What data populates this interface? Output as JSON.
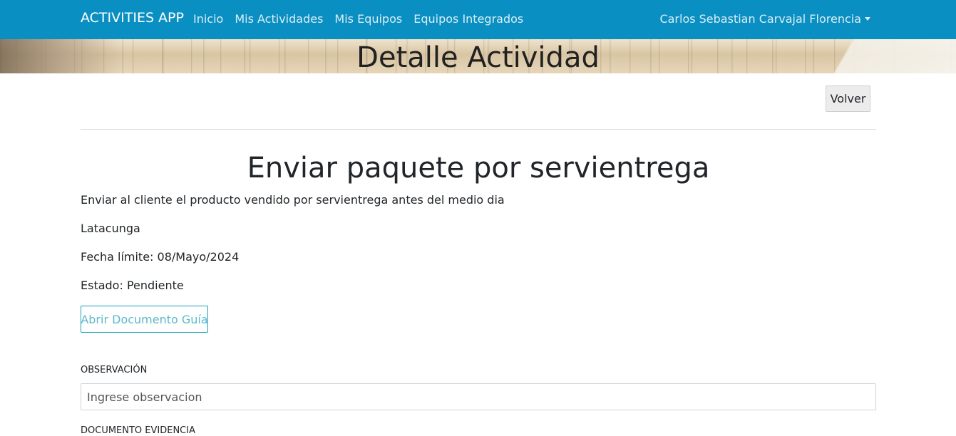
{
  "navbar": {
    "brand": "ACTIVITIES APP",
    "links": [
      "Inicio",
      "Mis Actividades",
      "Mis Equipos",
      "Equipos Integrados"
    ],
    "user_name": "Carlos Sebastian Carvajal Florencia"
  },
  "banner": {
    "title": "Detalle Actividad"
  },
  "actions": {
    "back_label": "Volver"
  },
  "activity": {
    "title": "Enviar paquete por servientrega",
    "description": "Enviar al cliente el producto vendido por servientrega antes del medio dia",
    "location": "Latacunga",
    "deadline": "Fecha límite: 08/Mayo/2024",
    "status": "Estado: Pendiente",
    "guide_button_label": "Abrir Documento Guía"
  },
  "form": {
    "observation_label": "Observación",
    "observation_placeholder": "Ingrese observacion",
    "observation_value": "",
    "evidence_label": "Documento Evidencia"
  },
  "colors": {
    "navbar": "#0a8fc2",
    "outline_button": "#17a2b8"
  }
}
